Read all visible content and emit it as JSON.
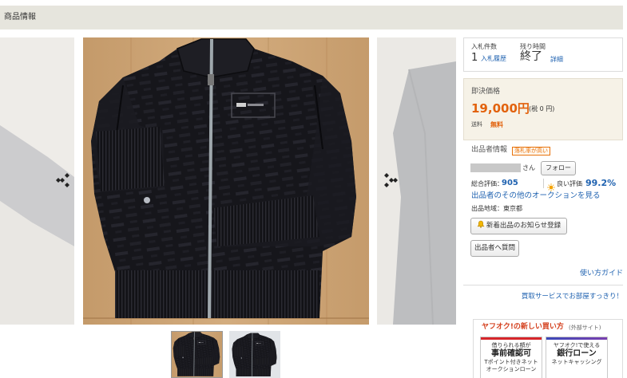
{
  "header": {
    "title": "商品情報"
  },
  "gallery": {
    "prev_icon": "arrow-left-icon",
    "next_icon": "arrow-right-icon",
    "selected_thumbnail": 1
  },
  "bid": {
    "count_label": "入札件数",
    "count": "1",
    "history_link": "入札履歴",
    "time_label": "残り時間",
    "time_value": "終了",
    "detail_link": "詳細"
  },
  "price": {
    "label": "即決価格",
    "value": "19,000円",
    "tax": "(税 0 円)",
    "shipping_label": "送料",
    "shipping_value": "無料"
  },
  "seller": {
    "heading": "出品者情報",
    "badge": "落札率が高い",
    "name_suffix": "さん",
    "follow_button": "フォロー",
    "rating_label": "総合評価：",
    "rating_value": "905",
    "good_icon": "sun-icon",
    "good_label": "良い評価",
    "good_value": "99.2%",
    "other_auctions_link": "出品者のその他のオークションを見る",
    "region": "出品地域：東京都",
    "notify_icon": "bell-icon",
    "notify_button": "新着出品のお知らせ登録",
    "question_button": "出品者へ質問"
  },
  "links": {
    "guide": "使い方ガイド",
    "kaitori": "買取サービスでお部屋すっきり！"
  },
  "new_ways": {
    "title": "ヤフオク!の新しい買い方",
    "note": "(外部サイト)",
    "cards": [
      {
        "line1": "借りられる額が",
        "line2": "事前確認可",
        "line3": "Tポイント付きネット",
        "line4": "オークションローン"
      },
      {
        "line1": "ヤフオク!で使える",
        "line2": "銀行ローン",
        "line3": "ネットキャッシング"
      }
    ]
  },
  "colors": {
    "header_bg": "#e6e5dd",
    "price": "#e2620d",
    "link": "#1f62b0",
    "price_box_bg": "#f6f2e7",
    "badge": "#e8730c",
    "new_ways_title": "#d4401e",
    "loan_red": "#d7262b",
    "loan_blue": "#3b48b8"
  }
}
